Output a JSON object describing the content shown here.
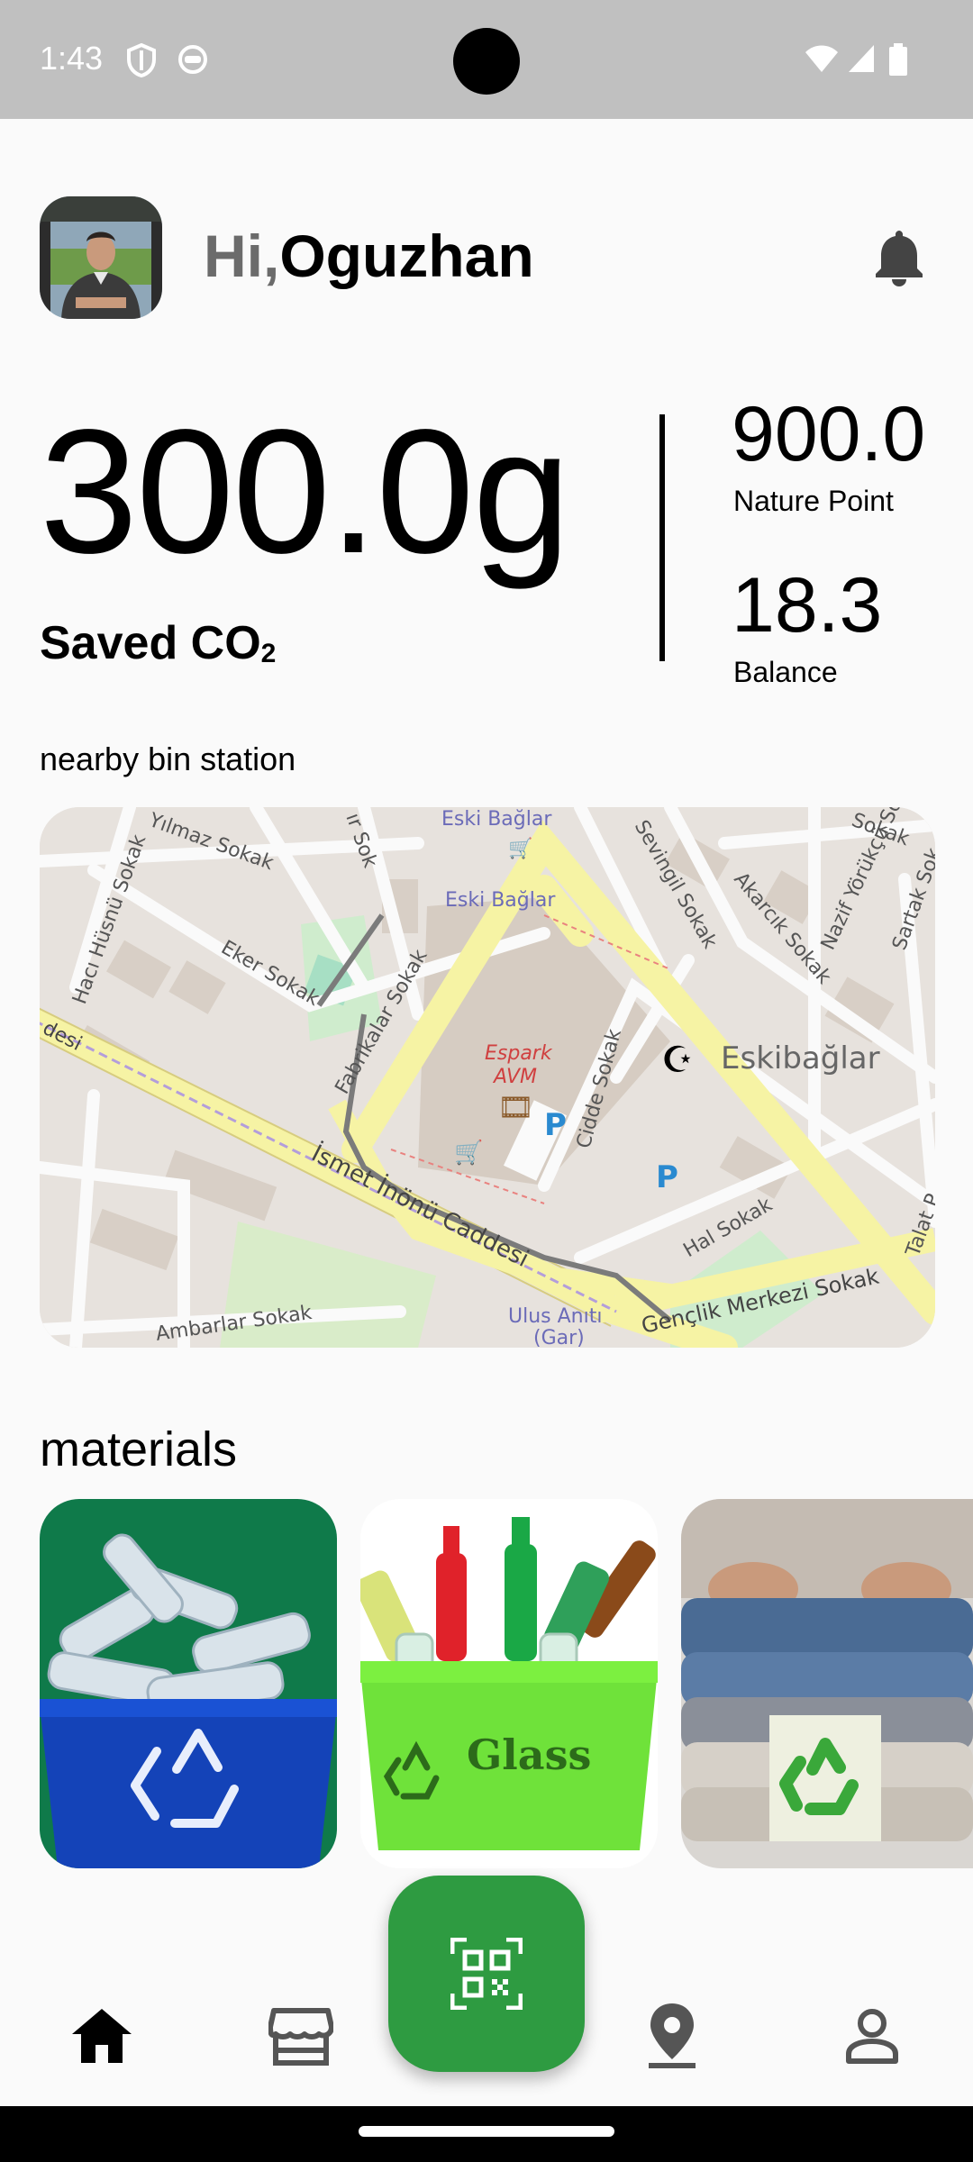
{
  "status": {
    "time": "1:43"
  },
  "header": {
    "greeting_prefix": "Hi,",
    "user_name": "Oguzhan"
  },
  "stats": {
    "saved_co2_value": "300.0g",
    "saved_co2_label": "Saved CO",
    "saved_co2_sub": "2",
    "nature_point_value": "900.0",
    "nature_point_label": "Nature Point",
    "balance_value": "18.3",
    "balance_label": "Balance"
  },
  "map": {
    "section_title": "nearby bin station",
    "labels": {
      "eski_baglar_top": "Eski Bağlar",
      "eski_baglar": "Eski Bağlar",
      "yilmaz": "Yılmaz Sokak",
      "haci": "Hacı Hüsnü Sokak",
      "eker": "Eker Sokak",
      "fabrikalar": "Fabrikalar Sokak",
      "espark": "Espark",
      "avm": "AVM",
      "eskibaglar": "Eskibağlar",
      "cidde": "Cidde Sokak",
      "sevingil": "Sevingil Sokak",
      "akarcik": "Akarcık Sokak",
      "nazif": "Nazif Yörükçü Sokak",
      "sartak": "Sartak Sok",
      "sokak_top": "Sokak",
      "ismet": "İsmet İnönü Caddesi",
      "desi": "desi",
      "hal": "Hal Sokak",
      "talat": "Talat P",
      "ulus": "Ulus Anıtı",
      "gar": "(Gar)",
      "genclik": "Gençlik Merkezi Sokak",
      "ambarlar": "Ambarlar Sokak",
      "ir_sok": "ır Sok"
    }
  },
  "materials": {
    "title": "materials",
    "items": [
      {
        "name": "plastic",
        "icon": "recycle-icon"
      },
      {
        "name": "glass",
        "label": "Glass"
      },
      {
        "name": "textile",
        "icon": "recycle-icon"
      }
    ]
  },
  "nav": {
    "items": [
      "home-icon",
      "store-icon",
      "location-icon",
      "profile-icon"
    ],
    "fab_icon": "qr-scan-icon"
  },
  "colors": {
    "accent": "#2e9b41",
    "map_bg": "#e7e2dd",
    "road_yellow": "#f6f3a4"
  }
}
